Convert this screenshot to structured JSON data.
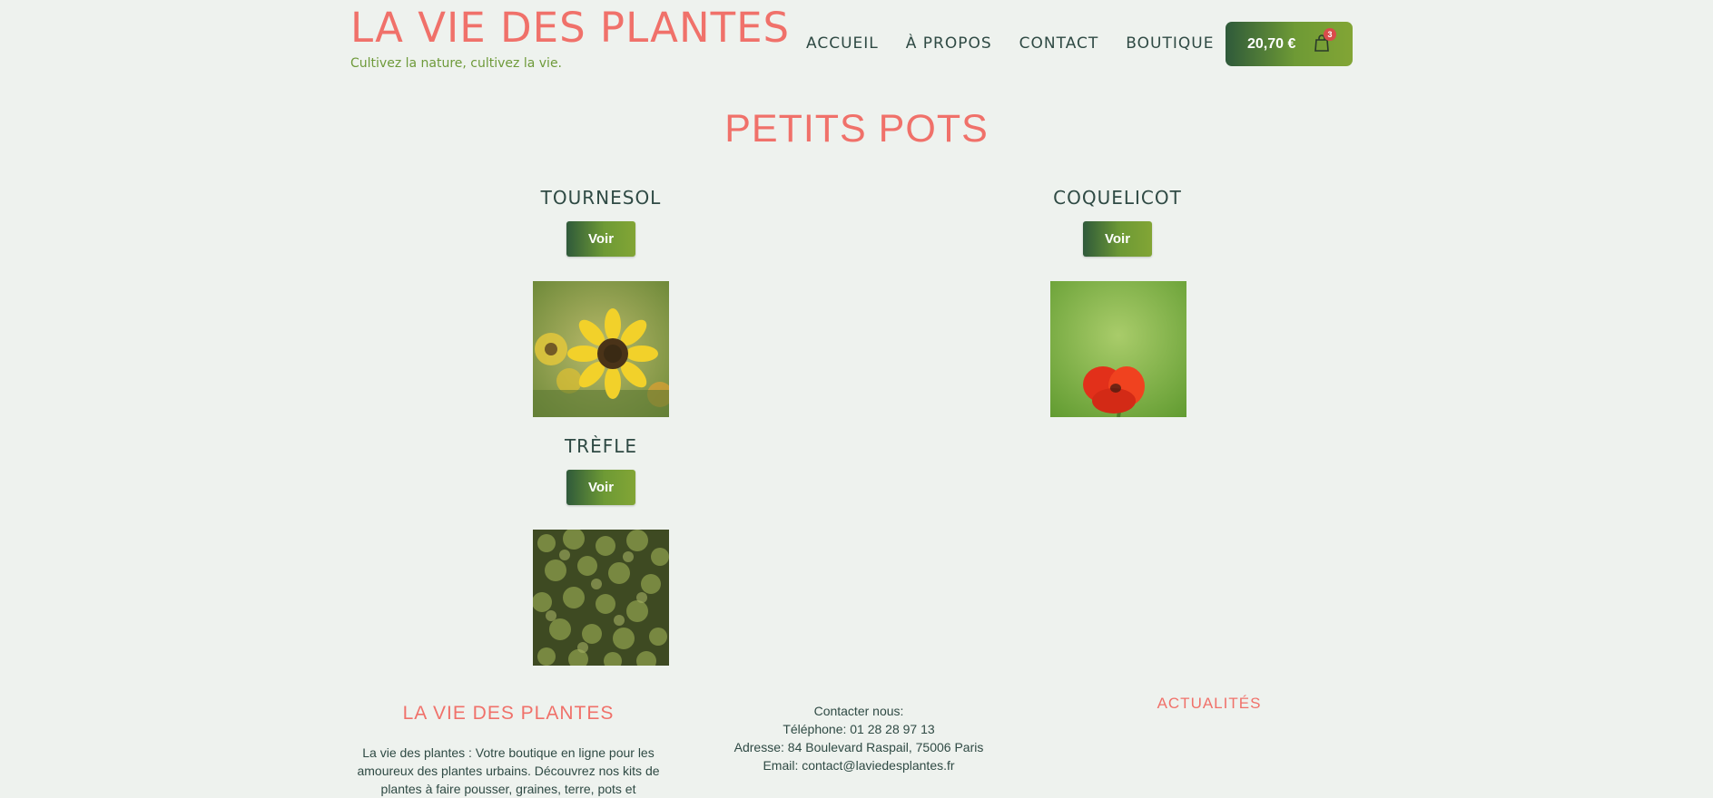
{
  "header": {
    "site_title": "LA VIE DES PLANTES",
    "tagline": "Cultivez la nature, cultivez la vie."
  },
  "nav": {
    "items": [
      {
        "label": "ACCUEIL"
      },
      {
        "label": "À PROPOS"
      },
      {
        "label": "CONTACT"
      },
      {
        "label": "BOUTIQUE"
      }
    ]
  },
  "cart": {
    "total": "20,70 €",
    "count": "3",
    "icon": "shopping-bag-icon"
  },
  "main": {
    "title": "PETITS POTS",
    "products": [
      {
        "name": "TOURNESOL",
        "button": "Voir",
        "image": "sunflower-photo"
      },
      {
        "name": "COQUELICOT",
        "button": "Voir",
        "image": "poppy-photo"
      },
      {
        "name": "TRÈFLE",
        "button": "Voir",
        "image": "clover-photo"
      }
    ]
  },
  "footer": {
    "about": {
      "heading": "LA VIE DES PLANTES",
      "text": "La vie des plantes : Votre boutique en ligne pour les amoureux des plantes urbains. Découvrez nos kits de plantes à faire pousser, graines, terre, pots et"
    },
    "contact": {
      "heading": "Contacter nous:",
      "phone": "Téléphone: 01 28 28 97 13",
      "address": "Adresse: 84 Boulevard Raspail, 75006 Paris",
      "email": "Email: contact@laviedesplantes.fr"
    },
    "news": {
      "heading": "ACTUALITÉS"
    }
  },
  "colors": {
    "background": "#eef2ee",
    "accent": "#f0716a",
    "green_dark": "#2f5a3a",
    "green_light": "#82a535",
    "text": "#2f4a44"
  }
}
